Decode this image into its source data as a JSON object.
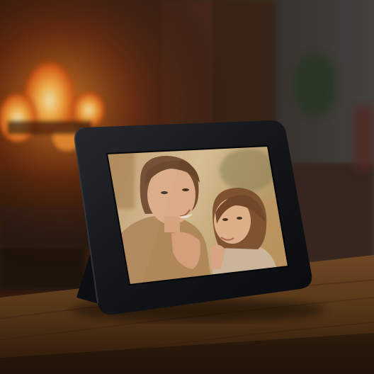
{
  "scene": {
    "description_tag": "photo",
    "colors": {
      "fire_core": "#ffd27a",
      "fire_mid": "#ff8a1e",
      "fire_outer": "#c8400c",
      "brick": "#4a2a1c",
      "wall_right": "#3c3a36",
      "table_top": "#6b4322",
      "table_edge": "#3a2412",
      "frame_bezel": "#121418",
      "frame_body": "#22252b",
      "photo_warm_bg": "#d9b98a",
      "skin": "#e9b48f",
      "hair_woman": "#6b4126",
      "hair_girl": "#7a4a2a",
      "sweater": "#b38a5e",
      "dress": "#d8c6b4"
    }
  }
}
